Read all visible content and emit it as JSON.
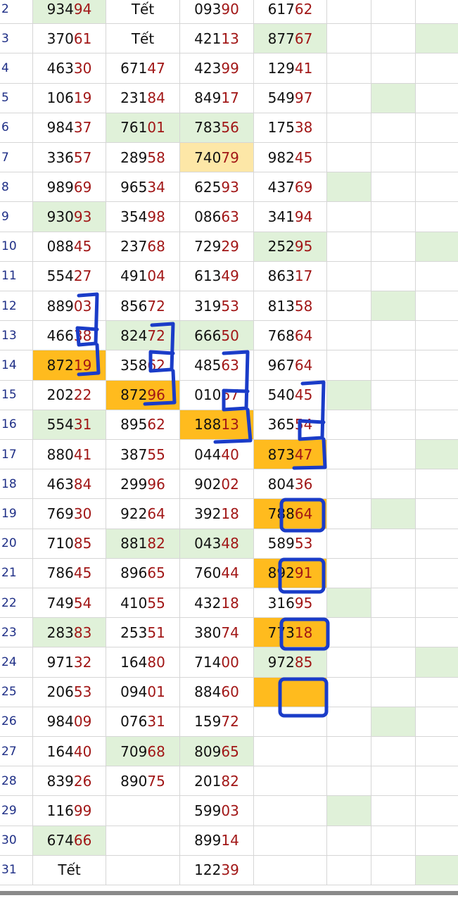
{
  "rows": [
    {
      "day": "2",
      "cols": [
        "93494",
        "Tết",
        "09390",
        "61762"
      ],
      "bg": [
        "green",
        "",
        "",
        ""
      ],
      "side": [
        "",
        "",
        ""
      ]
    },
    {
      "day": "3",
      "cols": [
        "37061",
        "Tết",
        "42113",
        "87767"
      ],
      "bg": [
        "",
        "",
        "",
        "green"
      ],
      "side": [
        "",
        "",
        "green"
      ]
    },
    {
      "day": "4",
      "cols": [
        "46330",
        "67147",
        "42399",
        "12941"
      ],
      "bg": [
        "",
        "",
        "",
        ""
      ],
      "side": [
        "",
        "",
        ""
      ]
    },
    {
      "day": "5",
      "cols": [
        "10619",
        "23184",
        "84917",
        "54997"
      ],
      "bg": [
        "",
        "",
        "",
        ""
      ],
      "side": [
        "",
        "green",
        ""
      ]
    },
    {
      "day": "6",
      "cols": [
        "98437",
        "76101",
        "78356",
        "17538"
      ],
      "bg": [
        "",
        "green",
        "green",
        ""
      ],
      "side": [
        "",
        "",
        ""
      ]
    },
    {
      "day": "7",
      "cols": [
        "33657",
        "28958",
        "74079",
        "98245"
      ],
      "bg": [
        "",
        "",
        "yellow",
        ""
      ],
      "side": [
        "",
        "",
        ""
      ]
    },
    {
      "day": "8",
      "cols": [
        "98969",
        "96534",
        "62593",
        "43769"
      ],
      "bg": [
        "",
        "",
        "",
        ""
      ],
      "side": [
        "green",
        "",
        ""
      ]
    },
    {
      "day": "9",
      "cols": [
        "93093",
        "35498",
        "08663",
        "34194"
      ],
      "bg": [
        "green",
        "",
        "",
        ""
      ],
      "side": [
        "",
        "",
        ""
      ]
    },
    {
      "day": "10",
      "cols": [
        "08845",
        "23768",
        "72929",
        "25295"
      ],
      "bg": [
        "",
        "",
        "",
        "green"
      ],
      "side": [
        "",
        "",
        "green"
      ]
    },
    {
      "day": "11",
      "cols": [
        "55427",
        "49104",
        "61349",
        "86317"
      ],
      "bg": [
        "",
        "",
        "",
        ""
      ],
      "side": [
        "",
        "",
        ""
      ]
    },
    {
      "day": "12",
      "cols": [
        "88903",
        "85672",
        "31953",
        "81358"
      ],
      "bg": [
        "",
        "",
        "",
        ""
      ],
      "side": [
        "",
        "green",
        ""
      ]
    },
    {
      "day": "13",
      "cols": [
        "46638",
        "82472",
        "66650",
        "76864"
      ],
      "bg": [
        "",
        "green",
        "green",
        ""
      ],
      "side": [
        "",
        "",
        ""
      ]
    },
    {
      "day": "14",
      "cols": [
        "87219",
        "35862",
        "48563",
        "96764"
      ],
      "bg": [
        "orange",
        "",
        "",
        ""
      ],
      "side": [
        "",
        "",
        ""
      ]
    },
    {
      "day": "15",
      "cols": [
        "20222",
        "87296",
        "01067",
        "54045"
      ],
      "bg": [
        "",
        "orange",
        "",
        ""
      ],
      "side": [
        "green",
        "",
        ""
      ]
    },
    {
      "day": "16",
      "cols": [
        "55431",
        "89562",
        "18813",
        "36554"
      ],
      "bg": [
        "green",
        "",
        "orange",
        ""
      ],
      "side": [
        "",
        "",
        ""
      ]
    },
    {
      "day": "17",
      "cols": [
        "88041",
        "38755",
        "04440",
        "87347"
      ],
      "bg": [
        "",
        "",
        "",
        "orange"
      ],
      "side": [
        "",
        "",
        "green"
      ]
    },
    {
      "day": "18",
      "cols": [
        "46384",
        "29996",
        "90202",
        "80436"
      ],
      "bg": [
        "",
        "",
        "",
        ""
      ],
      "side": [
        "",
        "",
        ""
      ]
    },
    {
      "day": "19",
      "cols": [
        "76930",
        "92264",
        "39218",
        "78864"
      ],
      "bg": [
        "",
        "",
        "",
        "orange"
      ],
      "side": [
        "",
        "green",
        ""
      ]
    },
    {
      "day": "20",
      "cols": [
        "71085",
        "88182",
        "04348",
        "58953"
      ],
      "bg": [
        "",
        "green",
        "green",
        ""
      ],
      "side": [
        "",
        "",
        ""
      ]
    },
    {
      "day": "21",
      "cols": [
        "78645",
        "89665",
        "76044",
        "89291"
      ],
      "bg": [
        "",
        "",
        "",
        "orange"
      ],
      "side": [
        "",
        "",
        ""
      ]
    },
    {
      "day": "22",
      "cols": [
        "74954",
        "41055",
        "43218",
        "31695"
      ],
      "bg": [
        "",
        "",
        "",
        ""
      ],
      "side": [
        "green",
        "",
        ""
      ]
    },
    {
      "day": "23",
      "cols": [
        "28383",
        "25351",
        "38074",
        "77318"
      ],
      "bg": [
        "green",
        "",
        "",
        "orange"
      ],
      "side": [
        "",
        "",
        ""
      ]
    },
    {
      "day": "24",
      "cols": [
        "97132",
        "16480",
        "71400",
        "97285"
      ],
      "bg": [
        "",
        "",
        "",
        "green"
      ],
      "side": [
        "",
        "",
        "green"
      ]
    },
    {
      "day": "25",
      "cols": [
        "20653",
        "09401",
        "88460",
        ""
      ],
      "bg": [
        "",
        "",
        "",
        "orange"
      ],
      "side": [
        "",
        "",
        ""
      ]
    },
    {
      "day": "26",
      "cols": [
        "98409",
        "07631",
        "15972",
        ""
      ],
      "bg": [
        "",
        "",
        "",
        ""
      ],
      "side": [
        "",
        "green",
        ""
      ]
    },
    {
      "day": "27",
      "cols": [
        "16440",
        "70968",
        "80965",
        ""
      ],
      "bg": [
        "",
        "green",
        "green",
        ""
      ],
      "side": [
        "",
        "",
        ""
      ]
    },
    {
      "day": "28",
      "cols": [
        "83926",
        "89075",
        "20182",
        ""
      ],
      "bg": [
        "",
        "",
        "",
        ""
      ],
      "side": [
        "",
        "",
        ""
      ]
    },
    {
      "day": "29",
      "cols": [
        "11699",
        "",
        "59903",
        ""
      ],
      "bg": [
        "",
        "",
        "",
        ""
      ],
      "side": [
        "green",
        "",
        ""
      ]
    },
    {
      "day": "30",
      "cols": [
        "67466",
        "",
        "89914",
        ""
      ],
      "bg": [
        "green",
        "",
        "",
        ""
      ],
      "side": [
        "",
        "",
        ""
      ]
    },
    {
      "day": "31",
      "cols": [
        "Tết",
        "",
        "12239",
        ""
      ],
      "bg": [
        "",
        "",
        "",
        ""
      ],
      "side": [
        "",
        "",
        "green"
      ]
    }
  ],
  "colors": {
    "green": "#e0f1d9",
    "orange": "#ffbb1e",
    "yellow": "#fde7a7",
    "tail": "#a11616",
    "day": "#1e2e86",
    "marker": "#1a3cc8"
  }
}
